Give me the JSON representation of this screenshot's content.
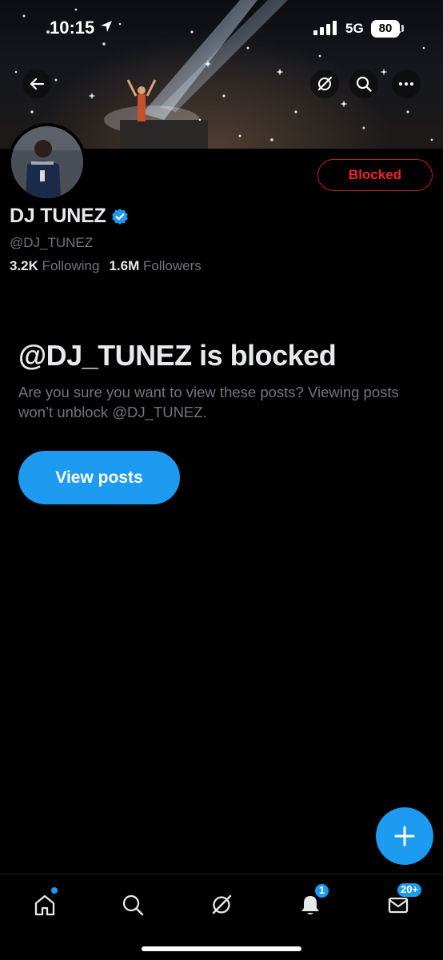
{
  "status_bar": {
    "time": "10:15",
    "network": "5G",
    "battery": "80"
  },
  "profile": {
    "name": "DJ TUNEZ",
    "handle": "@DJ_TUNEZ",
    "following_count": "3.2K",
    "following_label": "Following",
    "followers_count": "1.6M",
    "followers_label": "Followers",
    "blocked_button": "Blocked",
    "verified": true
  },
  "blocked_notice": {
    "title": "@DJ_TUNEZ is blocked",
    "description": "Are you sure you want to view these posts? Viewing posts won’t unblock @DJ_TUNEZ.",
    "view_button": "View posts"
  },
  "bottom_nav": {
    "items": [
      "home-icon",
      "search-icon",
      "grok-icon",
      "notifications-icon",
      "messages-icon"
    ],
    "notifications_badge": "1",
    "messages_badge": "20+"
  },
  "colors": {
    "accent": "#1d9bf0",
    "blocked_red": "#f4212e",
    "background": "#000000",
    "secondary_text": "#71767b"
  }
}
